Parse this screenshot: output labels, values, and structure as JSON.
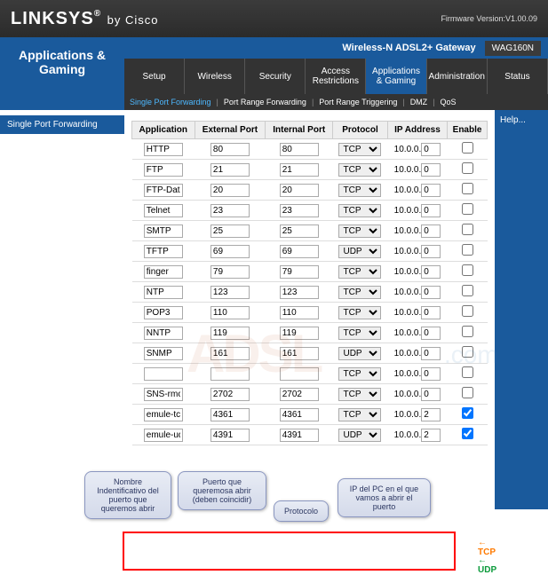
{
  "brand": {
    "name": "LINKSYS",
    "reg": "®",
    "by": "by Cisco"
  },
  "firmware": "Firmware Version:V1.00.09",
  "device": "Wireless-N ADSL2+ Gateway",
  "model": "WAG160N",
  "section": "Applications & Gaming",
  "tabs": [
    "Setup",
    "Wireless",
    "Security",
    "Access Restrictions",
    "Applications & Gaming",
    "Administration",
    "Status"
  ],
  "subtabs": [
    "Single Port Forwarding",
    "Port Range Forwarding",
    "Port Range Triggering",
    "DMZ",
    "QoS"
  ],
  "page_title": "Single Port Forwarding",
  "help": "Help...",
  "cols": {
    "app": "Application",
    "ext": "External Port",
    "int": "Internal Port",
    "proto": "Protocol",
    "ip": "IP Address",
    "en": "Enable"
  },
  "ip_prefix": "10.0.0.",
  "rows": [
    {
      "app": "HTTP",
      "ext": "80",
      "int": "80",
      "proto": "TCP",
      "ip": "0",
      "en": false
    },
    {
      "app": "FTP",
      "ext": "21",
      "int": "21",
      "proto": "TCP",
      "ip": "0",
      "en": false
    },
    {
      "app": "FTP-Data",
      "ext": "20",
      "int": "20",
      "proto": "TCP",
      "ip": "0",
      "en": false
    },
    {
      "app": "Telnet",
      "ext": "23",
      "int": "23",
      "proto": "TCP",
      "ip": "0",
      "en": false
    },
    {
      "app": "SMTP",
      "ext": "25",
      "int": "25",
      "proto": "TCP",
      "ip": "0",
      "en": false
    },
    {
      "app": "TFTP",
      "ext": "69",
      "int": "69",
      "proto": "UDP",
      "ip": "0",
      "en": false
    },
    {
      "app": "finger",
      "ext": "79",
      "int": "79",
      "proto": "TCP",
      "ip": "0",
      "en": false
    },
    {
      "app": "NTP",
      "ext": "123",
      "int": "123",
      "proto": "TCP",
      "ip": "0",
      "en": false
    },
    {
      "app": "POP3",
      "ext": "110",
      "int": "110",
      "proto": "TCP",
      "ip": "0",
      "en": false
    },
    {
      "app": "NNTP",
      "ext": "119",
      "int": "119",
      "proto": "TCP",
      "ip": "0",
      "en": false
    },
    {
      "app": "SNMP",
      "ext": "161",
      "int": "161",
      "proto": "UDP",
      "ip": "0",
      "en": false
    },
    {
      "app": "",
      "ext": "",
      "int": "",
      "proto": "TCP",
      "ip": "0",
      "en": false
    },
    {
      "app": "SNS-rmctl",
      "ext": "2702",
      "int": "2702",
      "proto": "TCP",
      "ip": "0",
      "en": false
    },
    {
      "app": "emule-tcp",
      "ext": "4361",
      "int": "4361",
      "proto": "TCP",
      "ip": "2",
      "en": true
    },
    {
      "app": "emule-udp",
      "ext": "4391",
      "int": "4391",
      "proto": "UDP",
      "ip": "2",
      "en": true
    }
  ],
  "callouts": {
    "c1": "Nombre Indentificativo del puerto que queremos abrir",
    "c2": "Puerto que queremosa abrir (deben coincidir)",
    "c3": "Protocolo",
    "c4": "IP del PC en el que vamos a abrir el puerto"
  },
  "labels": {
    "tcp": "TCP",
    "udp": "UDP"
  }
}
